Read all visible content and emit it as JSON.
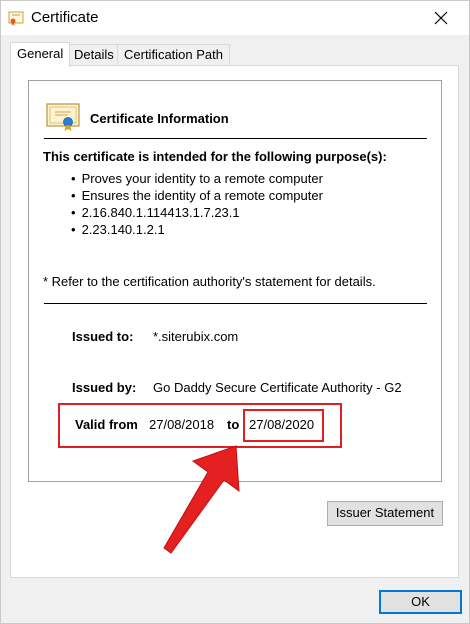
{
  "window": {
    "title": "Certificate",
    "close_glyph": "✕"
  },
  "tabs": [
    {
      "label": "General",
      "active": true
    },
    {
      "label": "Details",
      "active": false
    },
    {
      "label": "Certification Path",
      "active": false
    }
  ],
  "general": {
    "heading": "Certificate Information",
    "purpose_title": "This certificate is intended for the following purpose(s):",
    "purposes": [
      "Proves your identity to a remote computer",
      "Ensures the identity of a remote computer",
      "2.16.840.1.114413.1.7.23.1",
      "2.23.140.1.2.1"
    ],
    "note": "* Refer to the certification authority's statement for details.",
    "issued_to_label": "Issued to:",
    "issued_to_value": "*.siterubix.com",
    "issued_by_label": "Issued by:",
    "issued_by_value": "Go Daddy Secure Certificate Authority - G2",
    "valid_from_label": "Valid from",
    "valid_from_value": "27/08/2018",
    "valid_to_label": "to",
    "valid_to_value": "27/08/2020"
  },
  "buttons": {
    "issuer_statement": "Issuer Statement",
    "ok": "OK"
  },
  "colors": {
    "annotation": "#e02020",
    "focus": "#0078d7"
  }
}
